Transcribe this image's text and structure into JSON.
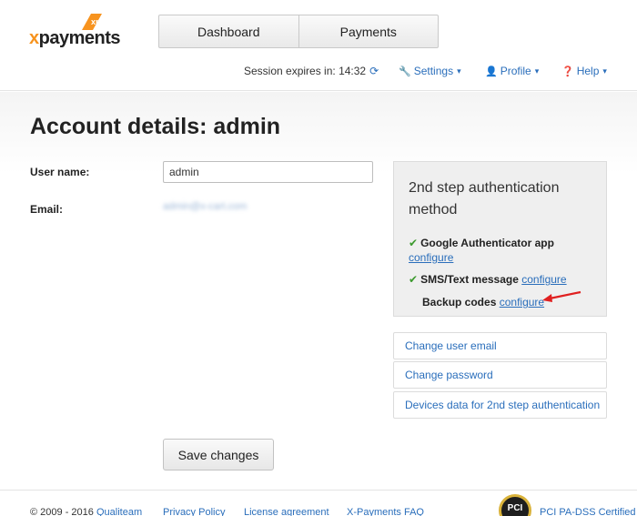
{
  "brand": {
    "logo_text_x": "x",
    "logo_text_rest": "payments",
    "accent": "#f7931e"
  },
  "nav": {
    "tabs": [
      {
        "label": "Dashboard"
      },
      {
        "label": "Payments"
      }
    ]
  },
  "topbar": {
    "session_label": "Session expires in:",
    "session_time": "14:32",
    "settings": "Settings",
    "profile": "Profile",
    "help": "Help"
  },
  "page": {
    "title": "Account details: admin"
  },
  "form": {
    "username_label": "User name:",
    "username_value": "admin",
    "email_label": "Email:",
    "email_value": "admin@x-cart.com",
    "save_label": "Save changes"
  },
  "twofa": {
    "title": "2nd step authentication method",
    "methods": [
      {
        "label": "Google Authenticator app",
        "enabled": true,
        "link": "configure"
      },
      {
        "label": "SMS/Text message",
        "enabled": true,
        "link": "configure"
      },
      {
        "label": "Backup codes",
        "enabled": false,
        "link": "configure"
      }
    ]
  },
  "links": [
    {
      "label": "Change user email"
    },
    {
      "label": "Change password"
    },
    {
      "label": "Devices data for 2nd step authentication"
    }
  ],
  "footer": {
    "copyright": "© 2009 - 2016",
    "links": [
      "Qualiteam",
      "Privacy Policy",
      "License agreement",
      "X-Payments FAQ"
    ],
    "pci_badge": "PCI",
    "pci_text": "PCI PA-DSS Certified"
  },
  "colors": {
    "link": "#2a6ebb",
    "check": "#3c9a2e",
    "arrow": "#e02020"
  }
}
